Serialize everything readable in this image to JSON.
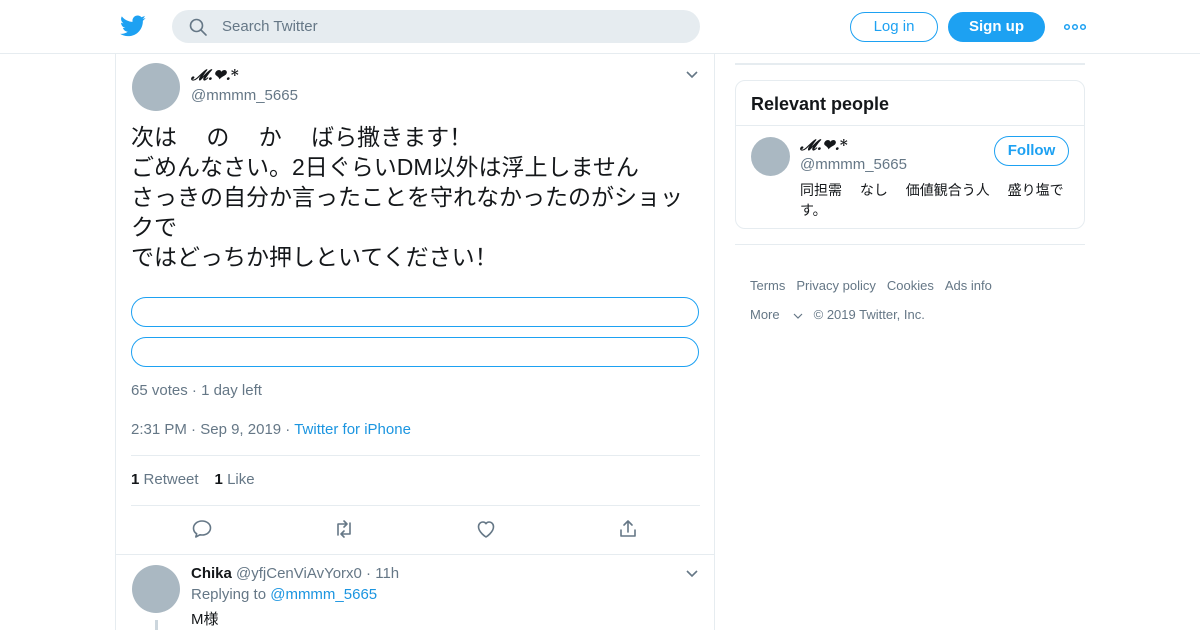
{
  "header": {
    "logo_icon": "twitter-bird-icon",
    "search_placeholder": "Search Twitter",
    "login_label": "Log in",
    "signup_label": "Sign up",
    "more_icon": "more-dots-icon",
    "accent_color": "#1da1f2"
  },
  "tweet": {
    "display_name": "𝓜.❤︎.*",
    "handle": "@mmmm_5665",
    "text_lines": [
      "次は　 の　 か　 ばら撒きます！",
      "ごめんなさい。2日ぐらいDM以外は浮上しません",
      "さっきの自分か言ったことを守れなかったのがショックで",
      "ではどっちか押しといてください！"
    ],
    "poll": {
      "options": [
        "",
        ""
      ],
      "votes": "65 votes",
      "time_left": "1 day left"
    },
    "time": "2:31 PM",
    "date": "Sep 9, 2019",
    "source": "Twitter for iPhone",
    "retweet_count": "1",
    "retweet_label": "Retweet",
    "like_count": "1",
    "like_label": "Like",
    "action_icons": [
      "reply-icon",
      "retweet-icon",
      "like-icon",
      "share-icon"
    ]
  },
  "reply": {
    "display_name": "Chika",
    "handle": "@yfjCenViAvYorx0",
    "time": "11h",
    "replying_to_label": "Replying to",
    "replying_to_handle": "@mmmm_5665",
    "text": "M様"
  },
  "sidebar": {
    "relevant_title": "Relevant people",
    "person": {
      "display_name": "𝓜.❤︎.*",
      "handle": "@mmmm_5665",
      "follow_label": "Follow",
      "bio": "同担需　 なし　 価値観合う人　 盛り塩です。"
    },
    "footer_links": [
      "Terms",
      "Privacy policy",
      "Cookies",
      "Ads info"
    ],
    "more_label": "More",
    "copyright": "© 2019 Twitter, Inc."
  }
}
